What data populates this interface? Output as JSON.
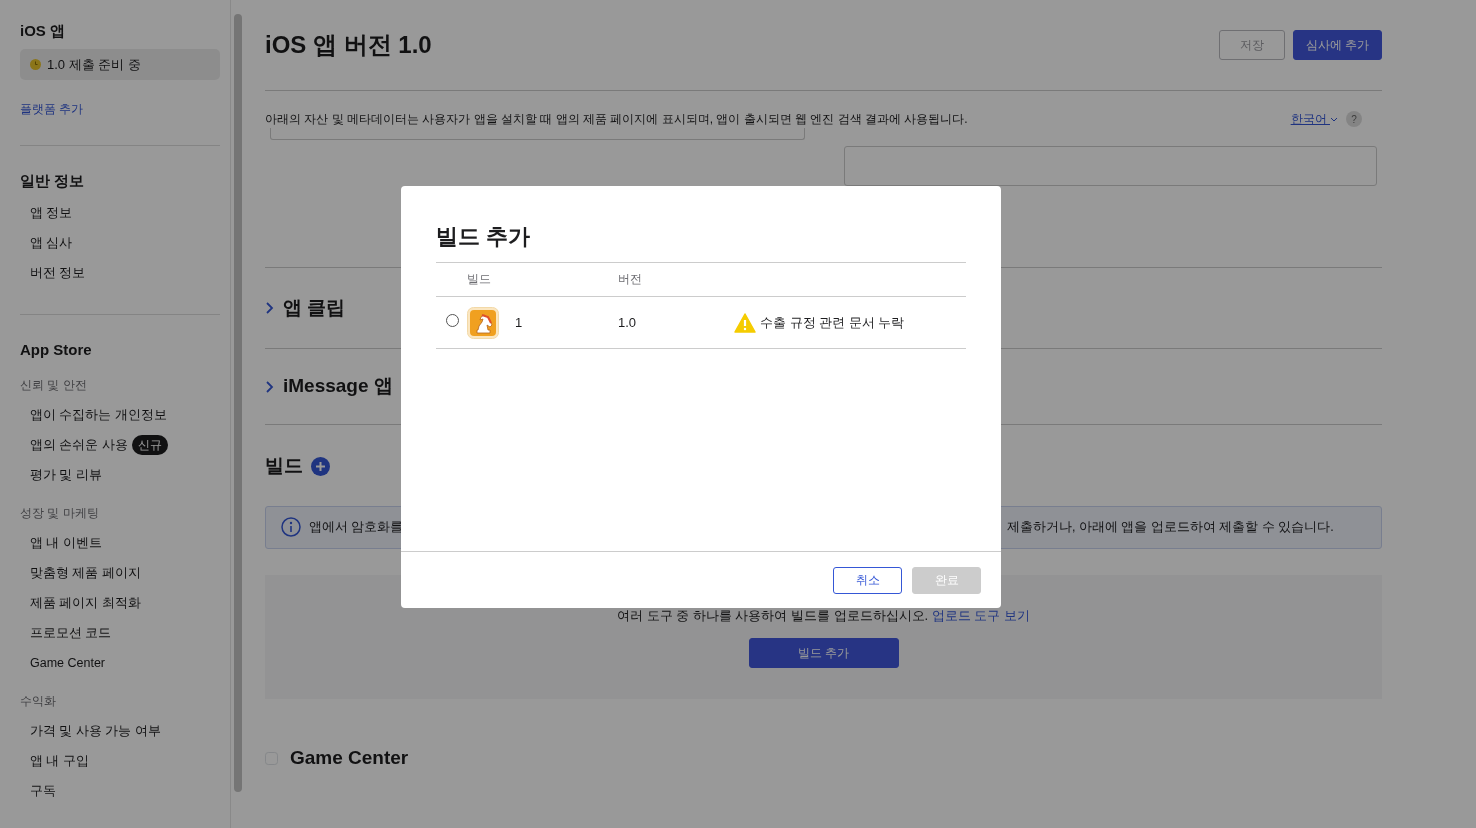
{
  "sidebar": {
    "platform_title": "iOS 앱",
    "status": "1.0 제출 준비 중",
    "add_platform": "플랫폼 추가",
    "sections": [
      {
        "title": "일반 정보",
        "categories": [
          {
            "items": [
              {
                "label": "앱 정보"
              },
              {
                "label": "앱 심사"
              },
              {
                "label": "버전 정보"
              }
            ]
          }
        ]
      },
      {
        "title": "App Store",
        "categories": [
          {
            "heading": "신뢰 및 안전",
            "items": [
              {
                "label": "앱이 수집하는 개인정보"
              },
              {
                "label": "앱의 손쉬운 사용",
                "badge": "신규"
              },
              {
                "label": "평가 및 리뷰"
              }
            ]
          },
          {
            "heading": "성장 및 마케팅",
            "items": [
              {
                "label": "앱 내 이벤트"
              },
              {
                "label": "맞춤형 제품 페이지"
              },
              {
                "label": "제품 페이지 최적화"
              },
              {
                "label": "프로모션 코드"
              },
              {
                "label": "Game Center"
              }
            ]
          },
          {
            "heading": "수익화",
            "items": [
              {
                "label": "가격 및 사용 가능 여부"
              },
              {
                "label": "앱 내 구입"
              },
              {
                "label": "구독"
              }
            ]
          }
        ]
      }
    ]
  },
  "main": {
    "title": "iOS 앱 버전 1.0",
    "buttons": [
      {
        "label": "저장",
        "kind": "outline",
        "disabled": true
      },
      {
        "label": "심사에 추가",
        "kind": "primary",
        "disabled": false
      }
    ],
    "description": "아래의 자산 및 메타데이터는 사용자가 앱을 설치할 때 앱의 제품 페이지에 표시되며, 앱이 출시되면 웹 엔진 검색 결과에 사용됩니다.",
    "language": "한국어",
    "help": "?",
    "sections": [
      {
        "title": "앱 클립",
        "expanded": false
      },
      {
        "title": "iMessage 앱",
        "expanded": false
      }
    ],
    "build": {
      "title": "빌드",
      "info_left": "앱에서 암호화를",
      "info_right": "제출하거나, 아래에 앱을 업로드하여 제출할 수 있습니다.",
      "upload_text": "여러 도구 중 하나를 사용하여 빌드를 업로드하십시오.",
      "upload_link": "업로드 도구 보기",
      "upload_button": "빌드 추가"
    },
    "game_center": {
      "label": "Game Center",
      "checked": false
    }
  },
  "modal": {
    "title": "빌드 추가",
    "columns": [
      "빌드",
      "버전"
    ],
    "rows": [
      {
        "selected": false,
        "build": "1",
        "version": "1.0",
        "warning": "수출 규정 관련 문서 누락"
      }
    ],
    "buttons": [
      {
        "label": "취소",
        "kind": "outline",
        "disabled": false
      },
      {
        "label": "완료",
        "kind": "primary",
        "disabled": true
      }
    ]
  }
}
